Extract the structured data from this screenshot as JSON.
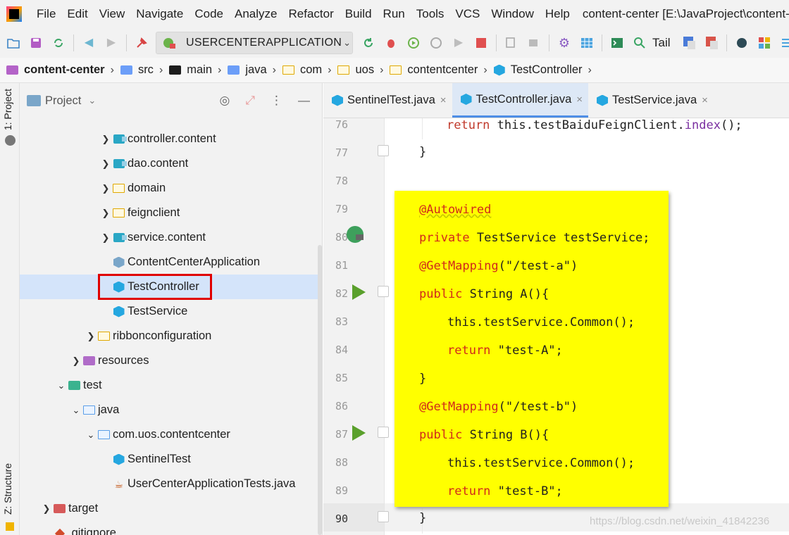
{
  "menubar": {
    "items": [
      "File",
      "Edit",
      "View",
      "Navigate",
      "Code",
      "Analyze",
      "Refactor",
      "Build",
      "Run",
      "Tools",
      "VCS",
      "Window",
      "Help"
    ],
    "window_title": "content-center [E:\\JavaProject\\content-center"
  },
  "toolbar": {
    "run_config": "USERCENTERAPPLICATION",
    "tail_label": "Tail"
  },
  "breadcrumb": {
    "items": [
      "content-center",
      "src",
      "main",
      "java",
      "com",
      "uos",
      "contentcenter",
      "TestController"
    ]
  },
  "sidebar": {
    "project_label": "1: Project",
    "structure_label": "Z: Structure"
  },
  "project_panel": {
    "title": "Project",
    "tree": [
      {
        "label": "controller.content",
        "icon": "package-icon"
      },
      {
        "label": "dao.content",
        "icon": "package-icon"
      },
      {
        "label": "domain",
        "icon": "folder-icon"
      },
      {
        "label": "feignclient",
        "icon": "folder-icon"
      },
      {
        "label": "service.content",
        "icon": "package-icon"
      },
      {
        "label": "ContentCenterApplication",
        "icon": "class-icon"
      },
      {
        "label": "TestController",
        "icon": "class-icon"
      },
      {
        "label": "TestService",
        "icon": "class-icon"
      },
      {
        "label": "ribbonconfiguration",
        "icon": "folder-icon"
      },
      {
        "label": "resources",
        "icon": "resources-folder-icon"
      },
      {
        "label": "test",
        "icon": "test-folder-icon"
      },
      {
        "label": "java",
        "icon": "folder-icon"
      },
      {
        "label": "com.uos.contentcenter",
        "icon": "folder-icon"
      },
      {
        "label": "SentinelTest",
        "icon": "class-icon"
      },
      {
        "label": "UserCenterApplicationTests.java",
        "icon": "java-file-icon"
      },
      {
        "label": "target",
        "icon": "target-folder-icon"
      },
      {
        "label": ".gitignore",
        "icon": "git-icon"
      }
    ],
    "selected": "TestController"
  },
  "editor_tabs": [
    {
      "label": "SentinelTest.java",
      "close": "×"
    },
    {
      "label": "TestController.java",
      "close": "×",
      "active": true
    },
    {
      "label": "TestService.java",
      "close": "×"
    }
  ],
  "editor": {
    "line_numbers": [
      "76",
      "77",
      "78",
      "79",
      "80",
      "81",
      "82",
      "83",
      "84",
      "85",
      "86",
      "87",
      "88",
      "89",
      "90"
    ],
    "line76": {
      "kw": "return",
      "text1": " this.testBaiduFeignClient.",
      "fn": "index",
      "text2": "();"
    },
    "line77": "}",
    "line90": "}",
    "highlight": {
      "l79": "@Autowired",
      "l80_kw": "private",
      "l80_rest": " TestService testService;",
      "l81_ann": "@GetMapping",
      "l81_rest": "(\"/test-a\")",
      "l82_kw": "public",
      "l82_rest": " String A(){",
      "l83": "this.testService.Common();",
      "l84_kw": "return",
      "l84_rest": " \"test-A\";",
      "l85": "}",
      "l86_ann": "@GetMapping",
      "l86_rest": "(\"/test-b\")",
      "l87_kw": "public",
      "l87_rest": " String B(){",
      "l88": "this.testService.Common();",
      "l89_kw": "return",
      "l89_rest": " \"test-B\";"
    }
  },
  "watermark": "https://blog.csdn.net/weixin_41842236"
}
